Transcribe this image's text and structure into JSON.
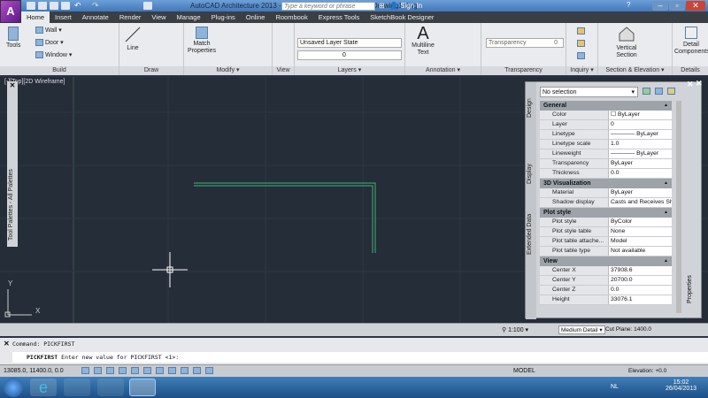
{
  "title": {
    "app": "AutoCAD Architecture 2013 - EDUCATIONAL VERSION",
    "file": "Drawing1.dwg",
    "search_placeholder": "Type a keyword or phrase",
    "sign_in": "Sign In",
    "logo": "A"
  },
  "tabs": [
    "Home",
    "Insert",
    "Annotate",
    "Render",
    "View",
    "Manage",
    "Plug-ins",
    "Online",
    "Roombook",
    "Express Tools",
    "SketchBook Designer"
  ],
  "ribbon": {
    "build": {
      "label": "Build",
      "tools": "Tools",
      "wall": "Wall",
      "door": "Door",
      "window": "Window"
    },
    "draw": {
      "label": "Draw",
      "line": "Line"
    },
    "modify": {
      "label": "Modify",
      "match": "Match Properties"
    },
    "view": {
      "label": "View"
    },
    "layers": {
      "label": "Layers",
      "state": "Unsaved Layer State",
      "layer": "0"
    },
    "annotation": {
      "label": "Annotation",
      "mtext": "Multiline Text",
      "mtext_glyph": "A"
    },
    "transparency": {
      "label": "Transparency",
      "field": "Transparency",
      "value": "0"
    },
    "inquiry": {
      "label": "Inquiry"
    },
    "section": {
      "label": "Section & Elevation",
      "vertical": "Vertical Section"
    },
    "details": {
      "label": "Details",
      "detail": "Detail Components"
    }
  },
  "viewport": {
    "label": "[-][Top][2D Wireframe]",
    "ucs_x": "X",
    "ucs_y": "Y"
  },
  "tool_palette": {
    "title": "Tool Palettes - All Palettes"
  },
  "properties": {
    "title": "Properties",
    "selection": "No selection",
    "side_tabs": [
      "Design",
      "Display",
      "Extended Data"
    ],
    "sections": [
      {
        "name": "General",
        "rows": [
          [
            "Color",
            "☐ ByLayer"
          ],
          [
            "Layer",
            "0"
          ],
          [
            "Linetype",
            "———— ByLayer"
          ],
          [
            "Linetype scale",
            "1.0"
          ],
          [
            "Lineweight",
            "———— ByLayer"
          ],
          [
            "Transparency",
            "ByLayer"
          ],
          [
            "Thickness",
            "0.0"
          ]
        ]
      },
      {
        "name": "3D Visualization",
        "rows": [
          [
            "Material",
            "ByLayer"
          ],
          [
            "Shadow display",
            "Casts and Receives Sh..."
          ]
        ]
      },
      {
        "name": "Plot style",
        "rows": [
          [
            "Plot style",
            "ByColor"
          ],
          [
            "Plot style table",
            "None"
          ],
          [
            "Plot table attache...",
            "Model"
          ],
          [
            "Plot table type",
            "Not available"
          ]
        ]
      },
      {
        "name": "View",
        "rows": [
          [
            "Center X",
            "37908.6"
          ],
          [
            "Center Y",
            "20700.0"
          ],
          [
            "Center Z",
            "0.0"
          ],
          [
            "Height",
            "33076.1"
          ]
        ]
      }
    ]
  },
  "status_strip": {
    "scale": "1:100",
    "detail": "Medium Detail",
    "cut_plane": "Cut Plane: 1400.0"
  },
  "command": {
    "history": "Command: PICKFIRST",
    "prompt_cmd": "PICKFIRST",
    "prompt": "Enter new value for PICKFIRST <1>:"
  },
  "statusbar": {
    "coords": "13085.0, 11400.0, 0.0",
    "model": "MODEL",
    "elevation": "Elevation: +0.0"
  },
  "taskbar": {
    "lang": "NL",
    "time": "15:02",
    "date": "26/04/2013"
  },
  "colors": {
    "canvas": "#252d38",
    "geometry": "#3f9a6a",
    "accent": "#3e74b8"
  }
}
